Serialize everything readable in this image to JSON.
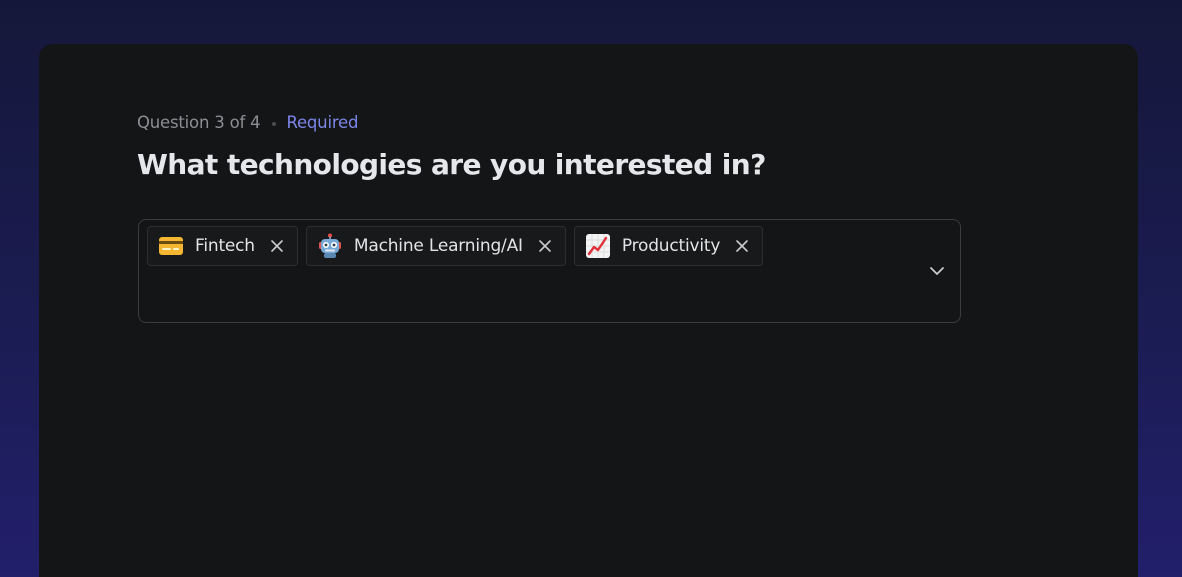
{
  "question": {
    "progress": "Question 3 of 4",
    "required_label": "Required",
    "title": "What technologies are you interested in?"
  },
  "multiselect": {
    "selected": [
      {
        "label": "Fintech",
        "icon": "credit-card-icon"
      },
      {
        "label": "Machine Learning/AI",
        "icon": "robot-icon"
      },
      {
        "label": "Productivity",
        "icon": "chart-increasing-icon"
      }
    ],
    "remove_icon": "close-icon",
    "toggle_icon": "chevron-down-icon"
  },
  "colors": {
    "accent": "#7b86e8",
    "card_background": "#141516",
    "page_background": "#1b1c52"
  }
}
